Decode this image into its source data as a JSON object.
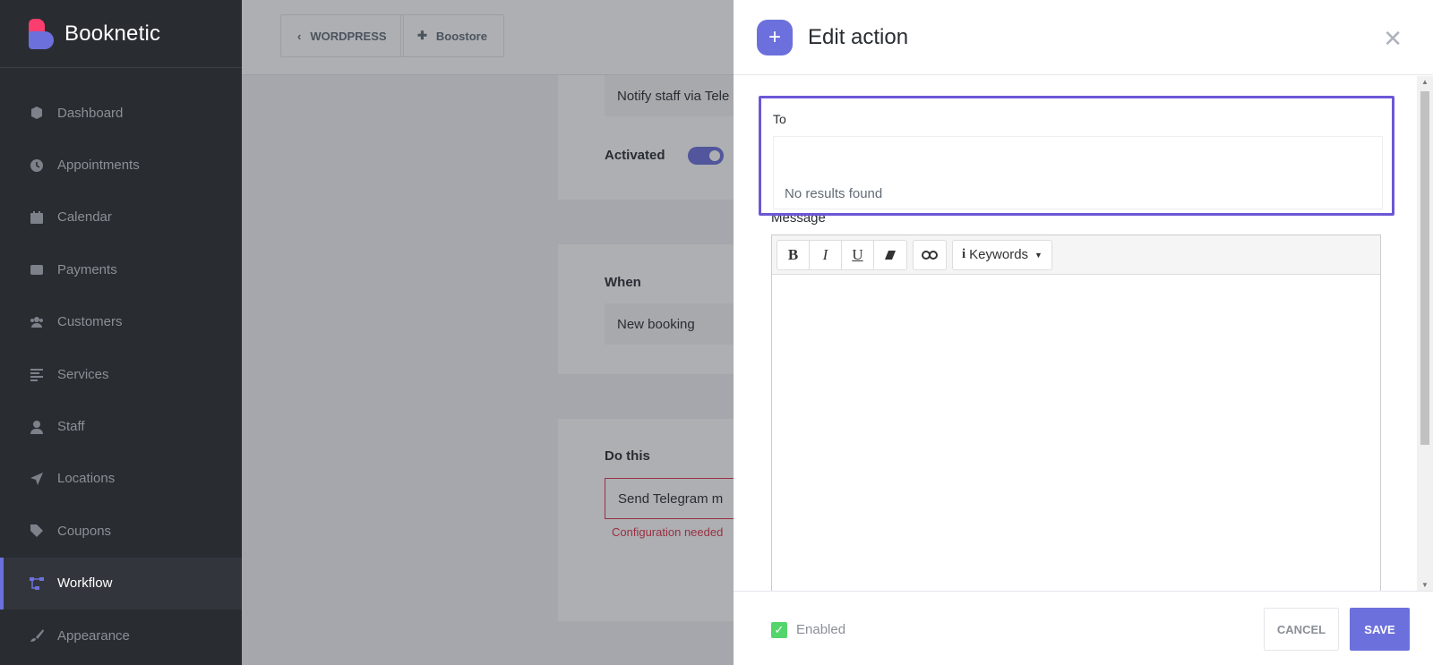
{
  "brand": {
    "name": "Booknetic"
  },
  "sidebar": {
    "items": [
      {
        "label": "Dashboard",
        "icon": "cube-icon"
      },
      {
        "label": "Appointments",
        "icon": "clock-icon"
      },
      {
        "label": "Calendar",
        "icon": "calendar-icon"
      },
      {
        "label": "Payments",
        "icon": "wallet-icon"
      },
      {
        "label": "Customers",
        "icon": "users-icon"
      },
      {
        "label": "Services",
        "icon": "list-icon"
      },
      {
        "label": "Staff",
        "icon": "user-icon"
      },
      {
        "label": "Locations",
        "icon": "location-arrow-icon"
      },
      {
        "label": "Coupons",
        "icon": "tag-icon"
      },
      {
        "label": "Workflow",
        "icon": "workflow-icon",
        "active": true
      },
      {
        "label": "Appearance",
        "icon": "brush-icon"
      }
    ]
  },
  "topbar": {
    "back_label": "WORDPRESS",
    "boostore_label": "Boostore"
  },
  "background": {
    "workflow_name": "Notify staff via Tele",
    "activated_label": "Activated",
    "when_label": "When",
    "when_value": "New booking",
    "do_this_label": "Do this",
    "action_value": "Send Telegram m",
    "config_warning": "Configuration needed"
  },
  "panel": {
    "title": "Edit action",
    "to_label": "To",
    "no_results": "No results found",
    "message_label": "Message",
    "toolbar": {
      "bold": "B",
      "italic": "I",
      "underline": "U",
      "keywords": "Keywords"
    },
    "enabled_label": "Enabled",
    "cancel_label": "CANCEL",
    "save_label": "SAVE"
  },
  "colors": {
    "accent": "#6c70dc",
    "sidebar_bg": "#292d32",
    "error": "#e0334e",
    "success": "#53d56c",
    "focus_border": "#6c57d5"
  }
}
